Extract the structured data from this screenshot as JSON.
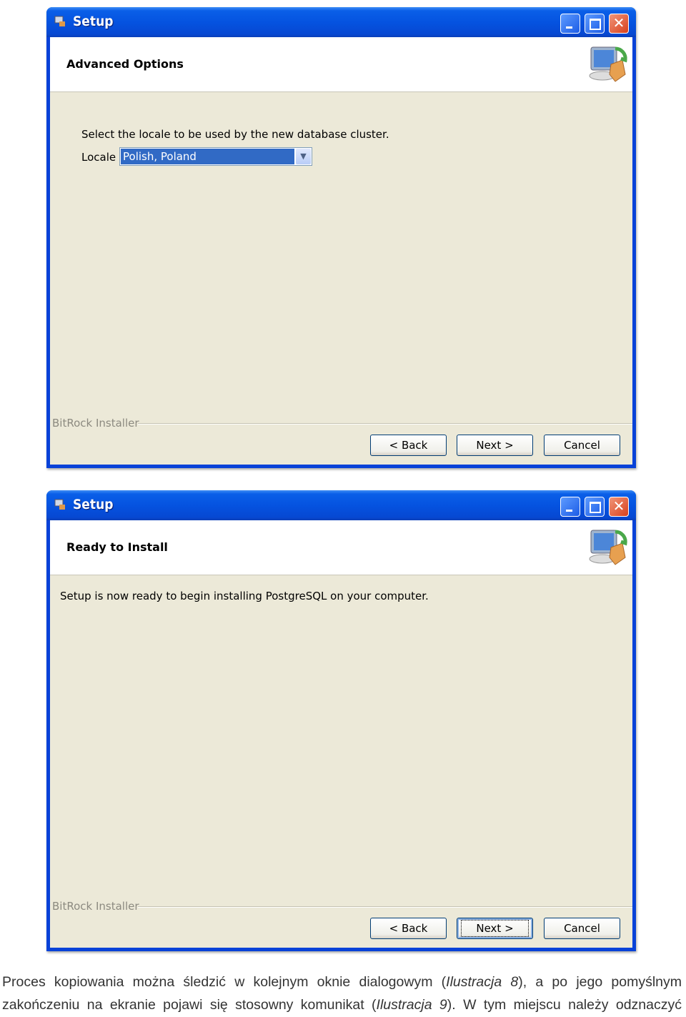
{
  "windows": [
    {
      "title": "Setup",
      "header": "Advanced Options",
      "instruction": "Select the locale to be used by the new database cluster.",
      "locale_label": "Locale",
      "locale_value": "Polish, Poland",
      "brand": "BitRock Installer",
      "back": "< Back",
      "next": "Next >",
      "cancel": "Cancel"
    },
    {
      "title": "Setup",
      "header": "Ready to Install",
      "instruction": "Setup is now ready to begin installing PostgreSQL on your computer.",
      "brand": "BitRock Installer",
      "back": "< Back",
      "next": "Next >",
      "cancel": "Cancel"
    }
  ],
  "paragraph": {
    "line1_a": "Proces kopiowania można śledzić w kolejnym oknie dialogowym (",
    "line1_ref": "Ilustracja 8",
    "line1_b": "), a po jego pomyślnym",
    "line2_a": "zakończeniu na ekranie pojawi się stosowny komunikat (",
    "line2_ref": "Ilustracja 9",
    "line2_b": "). W tym miejscu należy odznaczyć"
  },
  "colors": {
    "titlebar": "#0553e0",
    "dialog_bg": "#ece9d8",
    "selection": "#316ac5"
  }
}
